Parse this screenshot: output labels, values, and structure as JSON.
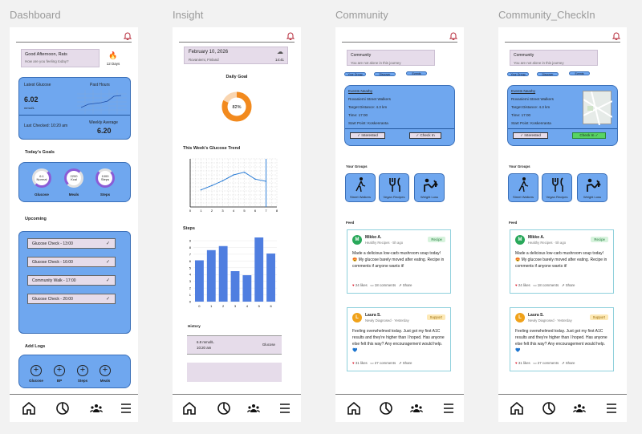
{
  "frames": [
    "Dashboard",
    "Insight",
    "Community",
    "Community_CheckIn"
  ],
  "dashboard": {
    "greeting": "Good Afternoon, Rats",
    "greeting_sub": "How are you feeling today?",
    "streak": "12 Days",
    "latest_label": "Latest Glucose",
    "latest_value": "6.02",
    "latest_unit": "mmol/L",
    "past_hours": "Past Hours",
    "last_checked": "Last Checked: 10:20 am",
    "weekly_label": "Weekly Average",
    "weekly_value": "6.20",
    "goals_title": "Today's Goals",
    "goals": [
      {
        "v": "6.1",
        "u": "Normal",
        "l": "Glucose"
      },
      {
        "v": "2200",
        "u": "Kcal",
        "l": "Meals"
      },
      {
        "v": "1000",
        "u": "Steps",
        "l": "Steps"
      }
    ],
    "upcoming_title": "Upcoming",
    "upcoming": [
      "Glucose Check - 13:00",
      "Glucose Check - 16:00",
      "Community Walk - 17:00",
      "Glucose Check - 20:00"
    ],
    "addlogs_title": "Add Logs",
    "logs": [
      "Glucose",
      "BP",
      "Steps",
      "Meals"
    ]
  },
  "insight": {
    "date": "February 10, 2026",
    "place": "Rovaniemi, Finland",
    "time": "14:41",
    "daily_goal": "Daily Goal",
    "pct": "82%",
    "trend_title": "This Week's Glucose Trend",
    "trend_x": [
      "0",
      "1",
      "2",
      "3",
      "4",
      "5",
      "6",
      "7",
      "8"
    ],
    "steps_title": "Steps",
    "steps_y": [
      "9",
      "8",
      "7",
      "6",
      "5",
      "4",
      "3",
      "2",
      "1",
      "0"
    ],
    "steps_x": [
      "0",
      "1",
      "2",
      "3",
      "4",
      "5",
      "6"
    ],
    "history_title": "History",
    "history_value": "6.8 mmol/L",
    "history_time": "10:20 am",
    "history_type": "Glucose"
  },
  "community": {
    "title": "Community",
    "sub": "You are not alone in this journey",
    "chips": [
      "Your Group",
      "Discover",
      "Events"
    ],
    "events_title": "Events Nearby",
    "ev_name": "Rovaniemi Street Walkers",
    "ev_distance": "Target Distance: 4.3 km",
    "ev_time": "Time: 17:00",
    "ev_start": "Start Point: Koskenranta",
    "interested": "Interested",
    "checkin": "Check In",
    "checkin2": "Check In",
    "groups_title": "Your Groups",
    "groups": [
      "Street Walkers",
      "Vegan Recipes",
      "Weight Loss"
    ],
    "feed_title": "Feed",
    "posts": [
      {
        "initial": "M",
        "name": "Mikko A.",
        "meta": "Healthy Recipes · 5h ago",
        "tag": "Recipe",
        "text": "Made a delicious low-carb mushroom soup today! 😍 My glucose barely moved after eating. Recipe in comments if anyone wants it!",
        "likes": "24 likes",
        "comments": "18 comments",
        "share": "Share"
      },
      {
        "initial": "L",
        "name": "Laura S.",
        "meta": "Newly Diagnosed · Yesterday",
        "tag": "Support",
        "text": "Feeling overwhelmed today. Just got my first A1C results and they're higher than I hoped. Has anyone else felt this way? Any encouragement would help. 💙",
        "likes": "31 likes",
        "comments": "27 comments",
        "share": "Share"
      }
    ]
  },
  "chart_data": [
    {
      "type": "bar",
      "title": "Steps",
      "categories": [
        "0",
        "1",
        "2",
        "3",
        "4",
        "5",
        "6"
      ],
      "values": [
        6.1,
        7.6,
        8.2,
        4.5,
        3.9,
        9.5,
        7.1
      ],
      "ylim": [
        0,
        9
      ]
    },
    {
      "type": "line",
      "title": "This Week's Glucose Trend",
      "x": [
        1,
        2,
        3,
        4,
        5,
        6,
        7
      ],
      "values": [
        3.2,
        4.0,
        4.9,
        6.0,
        6.5,
        5.2,
        4.8
      ],
      "ylim": [
        0,
        9
      ]
    },
    {
      "type": "pie",
      "title": "Daily Goal",
      "values": [
        82,
        18
      ]
    }
  ],
  "colors": {
    "blue": "#6fa7ef",
    "orange": "#f28a1e",
    "lavender": "#e6dcea",
    "steps_bar": "#4f7ee0"
  }
}
